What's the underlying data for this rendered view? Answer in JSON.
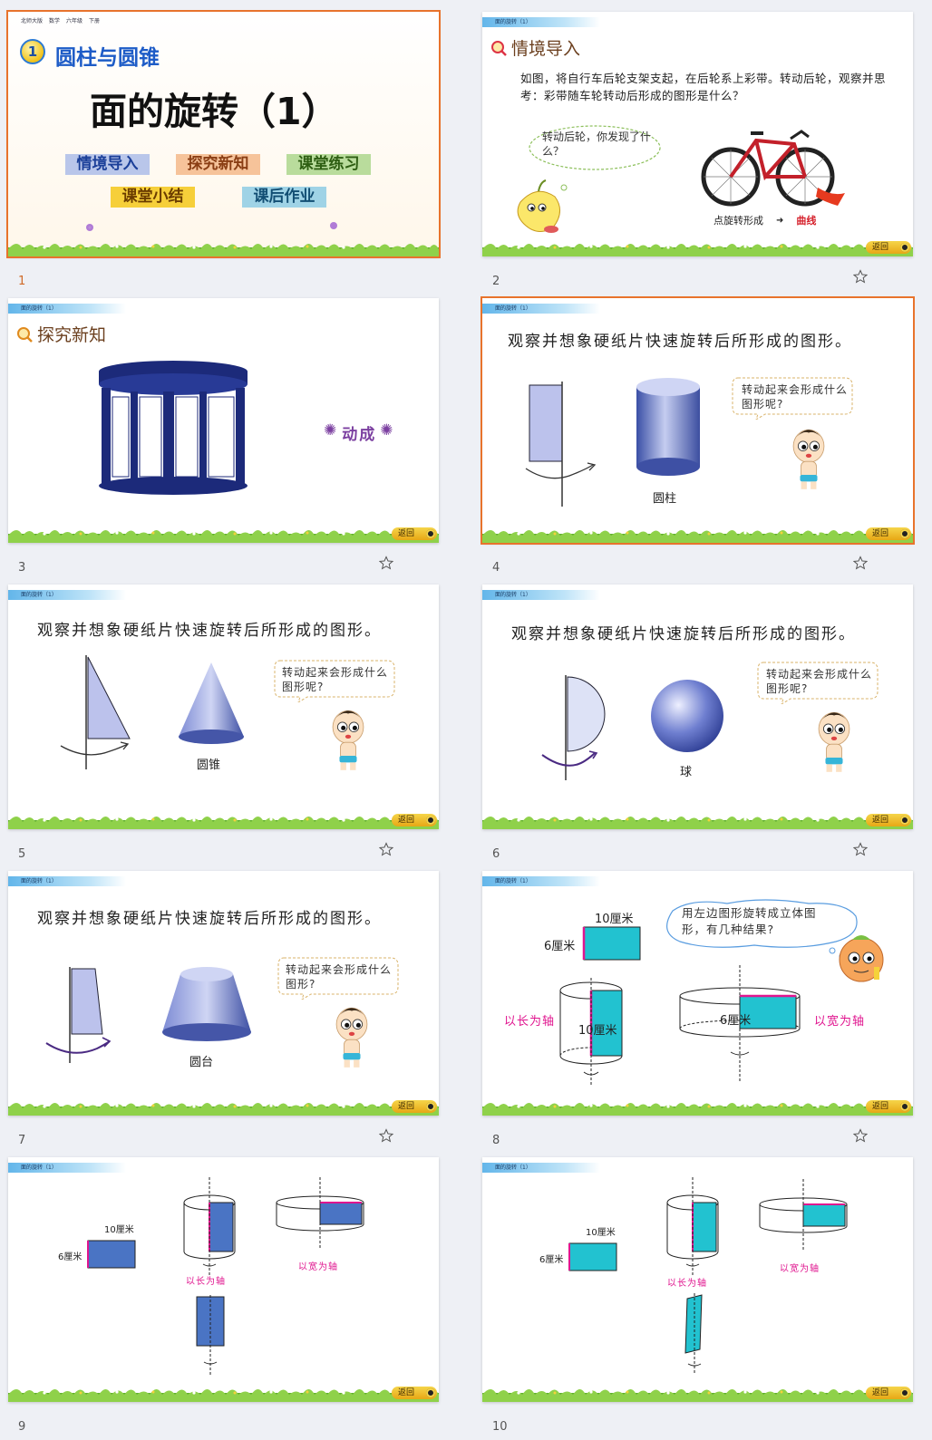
{
  "cover": {
    "subject_tags": [
      "北师大版",
      "数学",
      "六年级",
      "下册"
    ],
    "unit_no": "1",
    "unit_title": "圆柱与圆锥",
    "title": "面的旋转（1）",
    "nav": [
      "情境导入",
      "探究新知",
      "课堂练习",
      "课堂小结",
      "课后作业"
    ]
  },
  "common": {
    "tag": "面的旋转（1）",
    "back": "返回"
  },
  "slide_numbers": [
    "1",
    "2",
    "3",
    "4",
    "5",
    "6",
    "7",
    "8",
    "9",
    "10"
  ],
  "s2": {
    "section": "情境导入",
    "text": "如图，将自行车后轮支架支起，在后轮系上彩带。转动后轮，观察并思考：彩带随车轮转动后形成的图形是什么？",
    "bubble": "转动后轮，你发现了什么？",
    "caption_a": "点旋转形成",
    "caption_arrow": "➜",
    "caption_b": "曲线"
  },
  "s3": {
    "section": "探究新知",
    "label": "动成"
  },
  "heading": "观察并想象硬纸片快速旋转后所形成的图形。",
  "bubble_q": "转动起来会形成什么图形呢?",
  "bubble_q2": "转动起来会形成什么图形?",
  "s4": {
    "shape": "圆柱"
  },
  "s5": {
    "shape": "圆锥"
  },
  "s6": {
    "shape": "球"
  },
  "s7": {
    "shape": "圆台"
  },
  "s8": {
    "bubble": "用左边图形旋转成立体图形，有几种结果?",
    "w": "10厘米",
    "h": "6厘米",
    "axis_long": "以长为轴",
    "axis_wide": "以宽为轴",
    "cyl_a": "10厘米",
    "cyl_b": "6厘米"
  },
  "s9": {
    "w": "10厘米",
    "h": "6厘米",
    "axis_long": "以长为轴",
    "axis_wide": "以宽为轴"
  },
  "s10": {
    "w": "10厘米",
    "h": "6厘米",
    "axis_long": "以长为轴",
    "axis_wide": "以宽为轴"
  }
}
